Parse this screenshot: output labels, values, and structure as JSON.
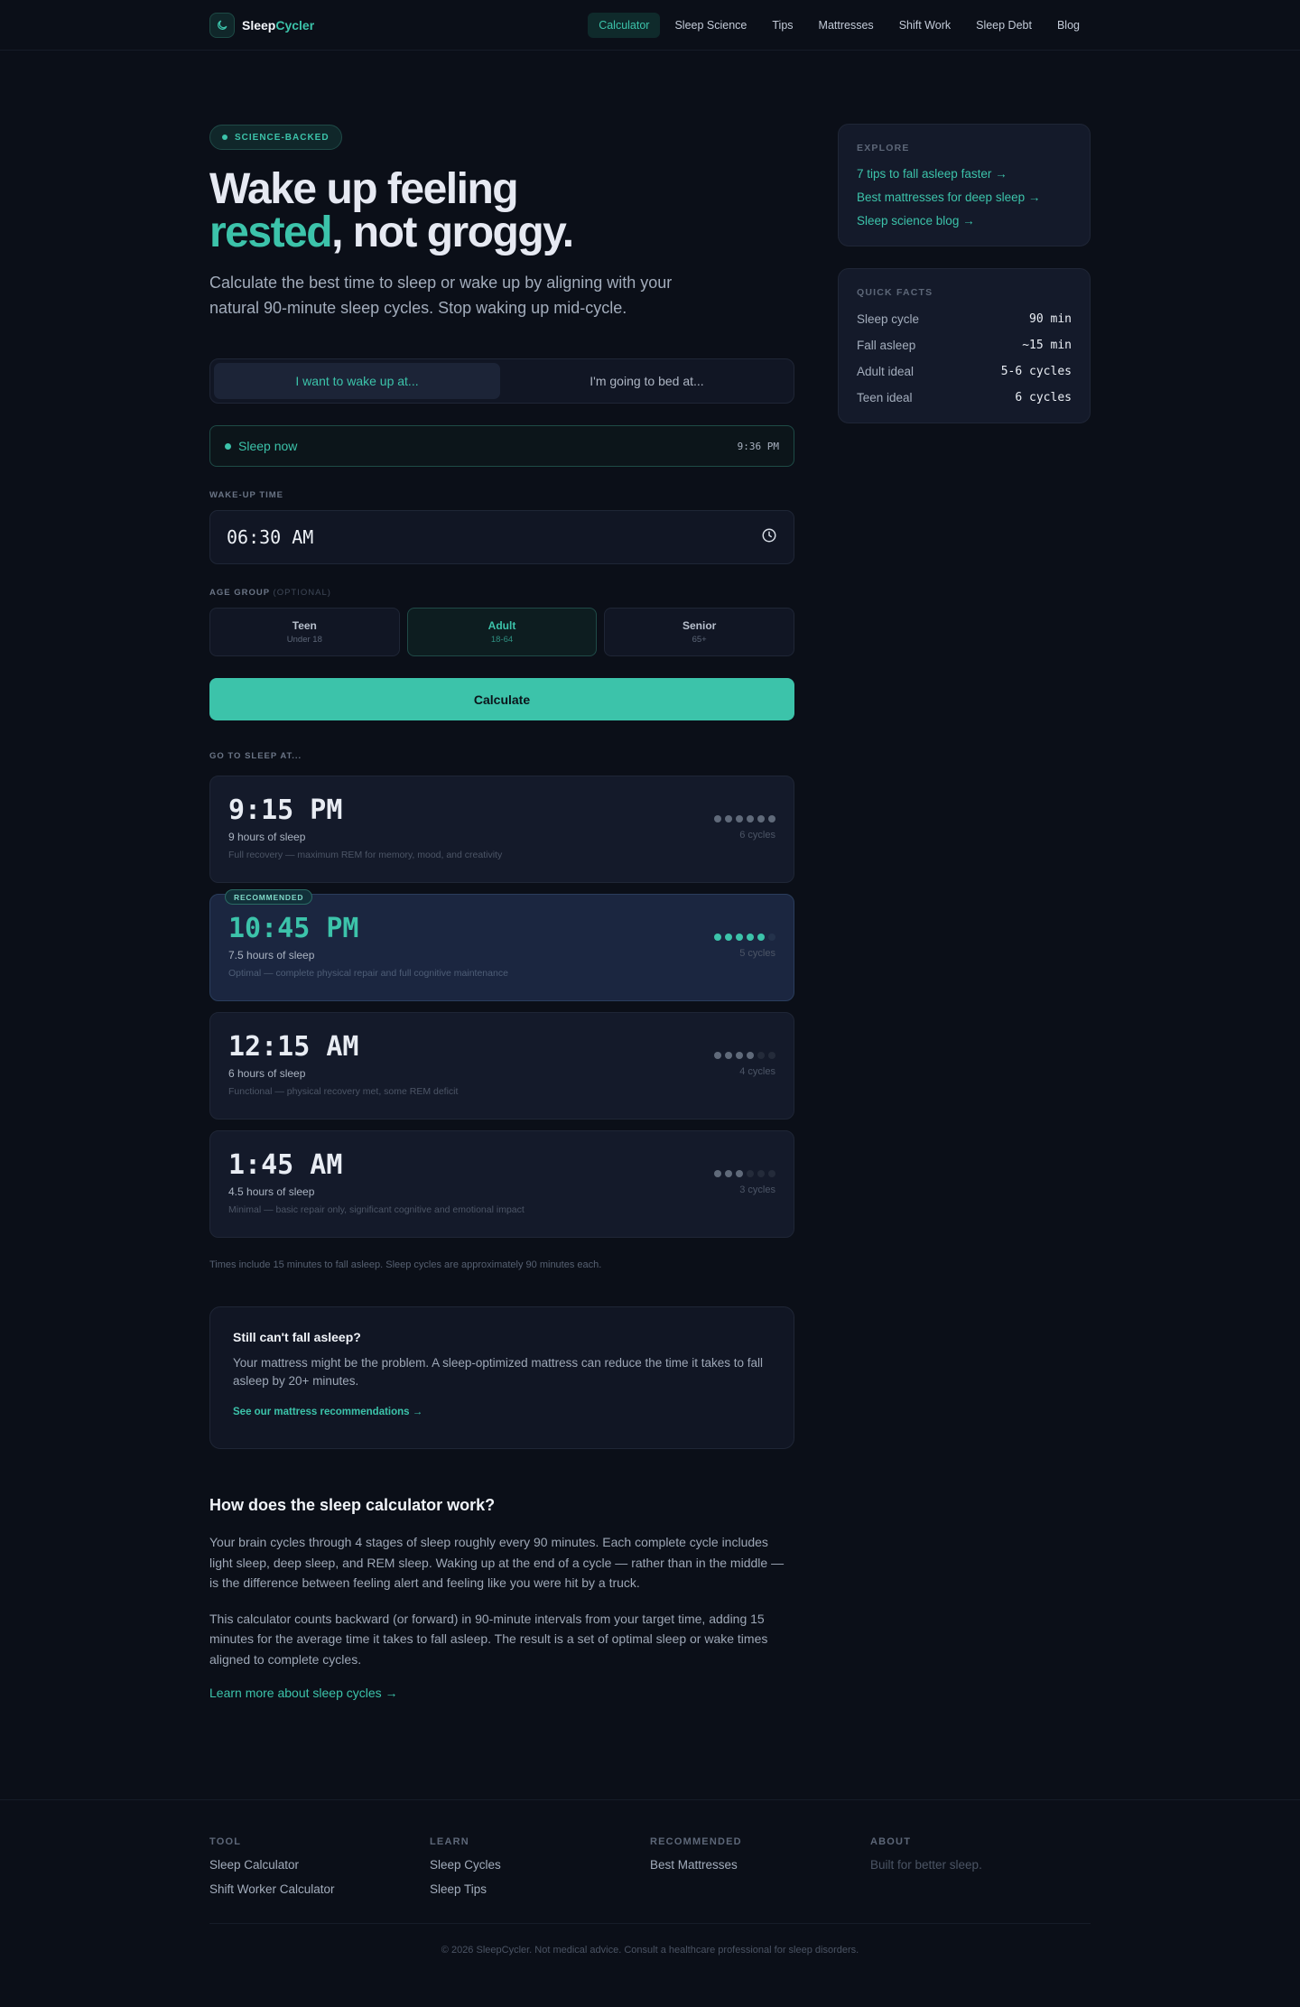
{
  "brand": {
    "part1": "Sleep",
    "part2": "Cycler",
    "icon": "moon-icon"
  },
  "nav": [
    {
      "label": "Calculator",
      "active": true
    },
    {
      "label": "Sleep Science"
    },
    {
      "label": "Tips"
    },
    {
      "label": "Mattresses"
    },
    {
      "label": "Shift Work"
    },
    {
      "label": "Sleep Debt"
    },
    {
      "label": "Blog"
    }
  ],
  "hero": {
    "badge": "SCIENCE-BACKED",
    "title_line1": "Wake up feeling",
    "title_accent": "rested",
    "title_rest": ", not groggy.",
    "lead": "Calculate the best time to sleep or wake up by aligning with your natural 90-minute sleep cycles. Stop waking up mid-cycle."
  },
  "tabs": {
    "wake": "I want to wake up at...",
    "bed": "I'm going to bed at..."
  },
  "sleep_now": {
    "label": "Sleep now",
    "time": "9:36 PM"
  },
  "wake_time": {
    "label": "WAKE-UP TIME",
    "value": "06:30 AM",
    "icon": "clock-icon"
  },
  "age_group": {
    "label": "AGE GROUP",
    "optional": "(OPTIONAL)",
    "options": [
      {
        "name": "Teen",
        "sub": "Under 18"
      },
      {
        "name": "Adult",
        "sub": "18-64",
        "selected": true
      },
      {
        "name": "Senior",
        "sub": "65+"
      }
    ]
  },
  "calculate_label": "Calculate",
  "results": {
    "label": "GO TO SLEEP AT...",
    "recommended_tag": "RECOMMENDED",
    "items": [
      {
        "time": "9:15 PM",
        "hours": "9 hours of sleep",
        "desc": "Full recovery — maximum REM for memory, mood, and creativity",
        "cycles": 6,
        "cycles_label": "6 cycles"
      },
      {
        "time": "10:45 PM",
        "hours": "7.5 hours of sleep",
        "desc": "Optimal — complete physical repair and full cognitive maintenance",
        "cycles": 5,
        "cycles_label": "5 cycles",
        "recommended": true
      },
      {
        "time": "12:15 AM",
        "hours": "6 hours of sleep",
        "desc": "Functional — physical recovery met, some REM deficit",
        "cycles": 4,
        "cycles_label": "4 cycles"
      },
      {
        "time": "1:45 AM",
        "hours": "4.5 hours of sleep",
        "desc": "Minimal — basic repair only, significant cognitive and emotional impact",
        "cycles": 3,
        "cycles_label": "3 cycles"
      }
    ],
    "note": "Times include 15 minutes to fall asleep. Sleep cycles are approximately 90 minutes each."
  },
  "cta": {
    "title": "Still can't fall asleep?",
    "text": "Your mattress might be the problem. A sleep-optimized mattress can reduce the time it takes to fall asleep by 20+ minutes.",
    "link": "See our mattress recommendations →"
  },
  "how": {
    "title": "How does the sleep calculator work?",
    "p1": "Your brain cycles through 4 stages of sleep roughly every 90 minutes. Each complete cycle includes light sleep, deep sleep, and REM sleep. Waking up at the end of a cycle — rather than in the middle — is the difference between feeling alert and feeling like you were hit by a truck.",
    "p2": "This calculator counts backward (or forward) in 90-minute intervals from your target time, adding 15 minutes for the average time it takes to fall asleep. The result is a set of optimal sleep or wake times aligned to complete cycles.",
    "link": "Learn more about sleep cycles →"
  },
  "explore": {
    "label": "EXPLORE",
    "links": [
      "7 tips to fall asleep faster →",
      "Best mattresses for deep sleep →",
      "Sleep science blog →"
    ]
  },
  "facts": {
    "label": "QUICK FACTS",
    "items": [
      {
        "k": "Sleep cycle",
        "v": "90 min"
      },
      {
        "k": "Fall asleep",
        "v": "~15 min"
      },
      {
        "k": "Adult ideal",
        "v": "5-6 cycles"
      },
      {
        "k": "Teen ideal",
        "v": "6 cycles"
      }
    ]
  },
  "footer": {
    "cols": [
      {
        "title": "TOOL",
        "items": [
          "Sleep Calculator",
          "Shift Worker Calculator"
        ]
      },
      {
        "title": "LEARN",
        "items": [
          "Sleep Cycles",
          "Sleep Tips"
        ]
      },
      {
        "title": "RECOMMENDED",
        "items": [
          "Best Mattresses"
        ]
      },
      {
        "title": "ABOUT",
        "items": [
          "Built for better sleep."
        ],
        "muted": true
      }
    ],
    "copyright": "© 2026 SleepCycler. Not medical advice. Consult a healthcare professional for sleep disorders."
  },
  "colors": {
    "accent": "#3cc3aa",
    "bg": "#0b0f18",
    "card": "#141a2a"
  }
}
